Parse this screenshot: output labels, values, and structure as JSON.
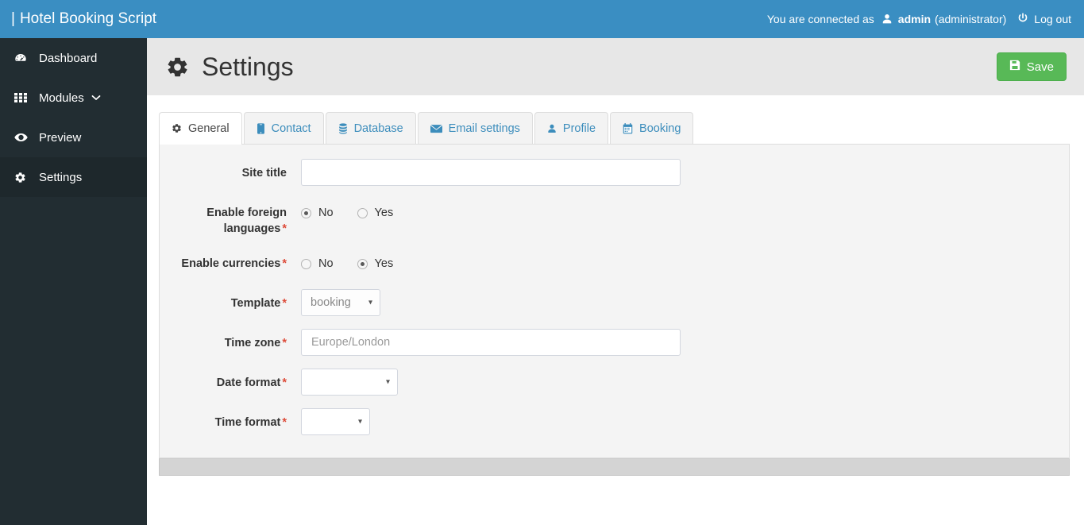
{
  "navbar": {
    "brand_bar": "|",
    "brand": "Hotel Booking Script",
    "connected_text": "You are connected as",
    "user_icon": "user-icon",
    "username": "admin",
    "role": "(administrator)",
    "power_icon": "power-icon",
    "logout": "Log out",
    "background_color": "#3a8ec2"
  },
  "sidebar": {
    "background_color": "#222d32",
    "active_color": "#1e282c",
    "items": [
      {
        "label": "Dashboard",
        "icon": "dashboard-icon",
        "active": false,
        "has_caret": false
      },
      {
        "label": "Modules",
        "icon": "grid-icon",
        "active": false,
        "has_caret": true
      },
      {
        "label": "Preview",
        "icon": "eye-icon",
        "active": false,
        "has_caret": false
      },
      {
        "label": "Settings",
        "icon": "gear-icon",
        "active": true,
        "has_caret": false
      }
    ]
  },
  "page": {
    "title": "Settings",
    "title_icon": "gear-icon",
    "save_label": "Save",
    "save_icon": "floppy-disk-icon",
    "save_color": "#58b957"
  },
  "tabs": [
    {
      "label": "General",
      "icon": "gear-icon",
      "active": true
    },
    {
      "label": "Contact",
      "icon": "phone-icon",
      "active": false
    },
    {
      "label": "Database",
      "icon": "database-icon",
      "active": false
    },
    {
      "label": "Email settings",
      "icon": "envelope-icon",
      "active": false
    },
    {
      "label": "Profile",
      "icon": "user-icon",
      "active": false
    },
    {
      "label": "Booking",
      "icon": "calendar-icon",
      "active": false
    }
  ],
  "form": {
    "site_title": {
      "label": "Site title",
      "required": false,
      "value": "",
      "placeholder": ""
    },
    "enable_foreign_languages": {
      "label": "Enable foreign languages",
      "required": true,
      "options": [
        "No",
        "Yes"
      ],
      "selected": "No"
    },
    "enable_currencies": {
      "label": "Enable currencies",
      "required": true,
      "options": [
        "No",
        "Yes"
      ],
      "selected": "Yes"
    },
    "template": {
      "label": "Template",
      "required": true,
      "selected": "booking"
    },
    "time_zone": {
      "label": "Time zone",
      "required": true,
      "value": "",
      "placeholder": "Europe/London"
    },
    "date_format": {
      "label": "Date format",
      "required": true,
      "selected": ""
    },
    "time_format": {
      "label": "Time format",
      "required": true,
      "selected": ""
    },
    "required_marker": "*"
  }
}
